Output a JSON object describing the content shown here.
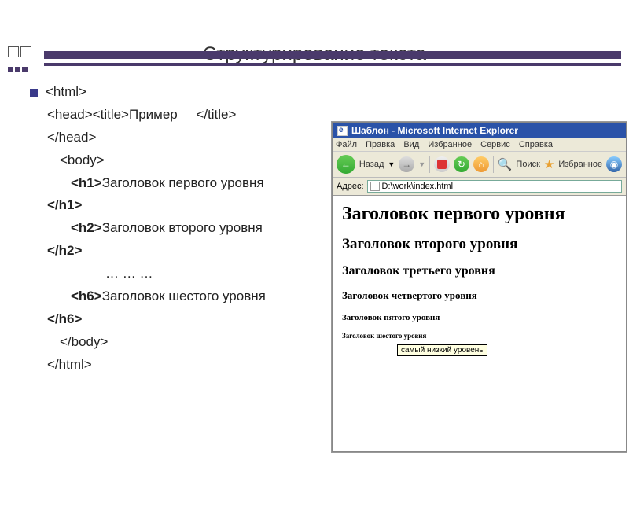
{
  "slide": {
    "title": "Структурирование текста"
  },
  "code": {
    "l1": "<html>",
    "l2a": "<head><title>",
    "l2b": "Пример",
    "l2c": "</title>",
    "l3": "</head>",
    "l4": "<body>",
    "h1o": "<h1>",
    "h1t": "Заголовок первого уровня",
    "h1c": "</h1>",
    "h2o": "<h2>",
    "h2t": "Заголовок второго уровня",
    "h2c": "</h2>",
    "dots": "… … …",
    "h6o": "<h6>",
    "h6t": "Заголовок шестого уровня",
    "h6c": "</h6>",
    "l8": "</body>",
    "l9": "</html>"
  },
  "browser": {
    "title": "Шаблон - Microsoft Internet Explorer",
    "menu": {
      "file": "Файл",
      "edit": "Правка",
      "view": "Вид",
      "fav": "Избранное",
      "tools": "Сервис",
      "help": "Справка"
    },
    "toolbar": {
      "back": "Назад",
      "search": "Поиск",
      "fav": "Избранное"
    },
    "addr_label": "Адрес:",
    "addr_value": "D:\\work\\index.html",
    "page": {
      "h1": "Заголовок первого уровня",
      "h2": "Заголовок второго уровня",
      "h3": "Заголовок третьего уровня",
      "h4": "Заголовок четвертого уровня",
      "h5": "Заголовок пятого уровня",
      "h6": "Заголовок шестого уровня"
    },
    "tooltip": "самый низкий уровень"
  }
}
